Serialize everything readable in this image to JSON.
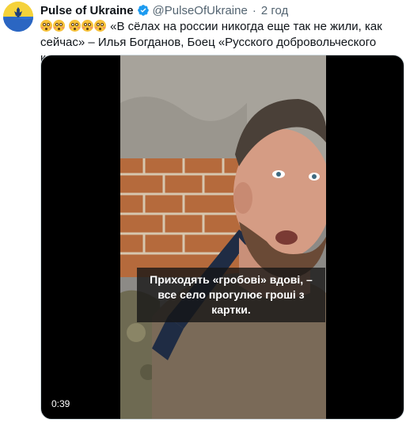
{
  "tweet": {
    "author_name": "Pulse of Ukraine",
    "handle": "@PulseOfUkraine",
    "separator": "·",
    "time": "2 год",
    "verified_icon": "verified-badge-icon",
    "avatar_icon": "ukraine-flag-avatar",
    "text_main": "«В сёлах на россии никогда еще так не жили, как сейчас» – Илья Богданов, Боец «Русского добровольческого корпуса»",
    "emoji": "astonished-face-emoji"
  },
  "media": {
    "subtitle": "Приходять «гробові» вдові, – все село прогулює гроші з картки.",
    "duration": "0:39"
  },
  "colors": {
    "text": "#0f1419",
    "secondary": "#536471",
    "verified": "#1d9bf0",
    "media_background": "#000000"
  }
}
